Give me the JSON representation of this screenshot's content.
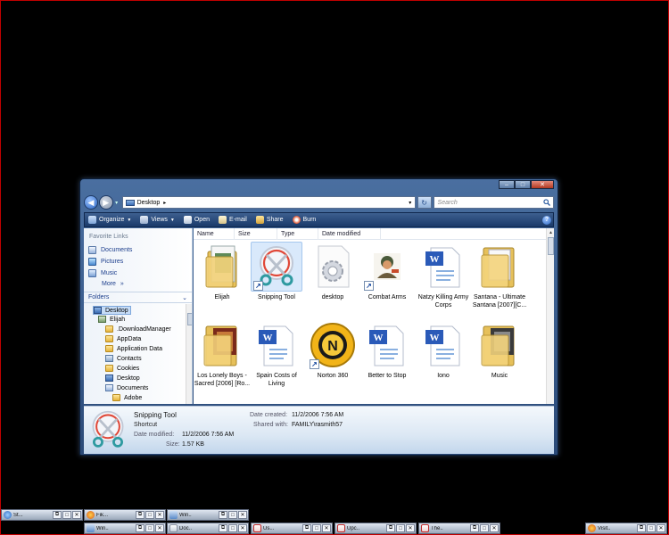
{
  "window": {
    "address": {
      "location": "Desktop"
    },
    "search": {
      "placeholder": "Search"
    },
    "toolbar": {
      "organize": "Organize",
      "views": "Views",
      "open": "Open",
      "email": "E-mail",
      "share": "Share",
      "burn": "Burn",
      "help": "?"
    },
    "navpane": {
      "favorites_heading": "Favorite Links",
      "favorites": [
        "Documents",
        "Pictures",
        "Music"
      ],
      "more": "More",
      "folders_heading": "Folders",
      "tree": [
        "Desktop",
        "Elijah",
        ".DownloadManager",
        "AppData",
        "Application Data",
        "Contacts",
        "Cookies",
        "Desktop",
        "Documents",
        "Adobe"
      ]
    },
    "columns": [
      "Name",
      "Size",
      "Type",
      "Date modified"
    ],
    "files": [
      {
        "label": "Elijah",
        "icon": "user-folder-icon"
      },
      {
        "label": "Snipping Tool",
        "icon": "snipping-tool-icon",
        "shortcut": true,
        "selected": true
      },
      {
        "label": "desktop",
        "icon": "settings-file-icon"
      },
      {
        "label": "Combat Arms",
        "icon": "game-icon",
        "shortcut": true
      },
      {
        "label": "Natzy Killing Army Corps",
        "icon": "word-document-icon"
      },
      {
        "label": "Santana - Ultimate Santana [2007][C...",
        "icon": "folder-icon"
      },
      {
        "label": "Los Lonely Boys - Sacred [2006] [Ro...",
        "icon": "album-folder-icon"
      },
      {
        "label": "Spain Costs of Living",
        "icon": "word-document-icon"
      },
      {
        "label": "Norton 360",
        "icon": "norton-icon",
        "shortcut": true
      },
      {
        "label": "Better to Stop",
        "icon": "word-document-icon"
      },
      {
        "label": "Iono",
        "icon": "word-document-icon"
      },
      {
        "label": "Music",
        "icon": "music-folder-icon"
      }
    ],
    "details": {
      "name": "Snipping Tool",
      "kind": "Shortcut",
      "date_modified_label": "Date modified:",
      "date_modified": "11/2/2006 7:56 AM",
      "size_label": "Size:",
      "size": "1.57 KB",
      "date_created_label": "Date created:",
      "date_created": "11/2/2006 7:56 AM",
      "shared_with_label": "Shared with:",
      "shared_with": "FAMILY\\rasmith57"
    }
  },
  "taskbar": {
    "top_row": [
      {
        "label": "St...",
        "icon": "start-orb-icon"
      },
      {
        "label": "Fik...",
        "icon": "firefox-icon"
      },
      {
        "label": "Win...",
        "icon": "window-icon"
      }
    ],
    "bottom_row": [
      {
        "label": "Win...",
        "icon": "window-icon"
      },
      {
        "label": "Doc...",
        "icon": "document-icon"
      },
      {
        "label": "Us...",
        "icon": "pdf-icon"
      },
      {
        "label": "Upc...",
        "icon": "pdf-icon"
      },
      {
        "label": "The...",
        "icon": "pdf-icon"
      },
      {
        "label": "Visit...",
        "icon": "firefox-icon"
      }
    ]
  },
  "colors": {
    "titlebar": "#2b4a78",
    "toolbar": "#1a3a6a",
    "selection": "#d9e9fb",
    "border_red": "#c00000"
  }
}
